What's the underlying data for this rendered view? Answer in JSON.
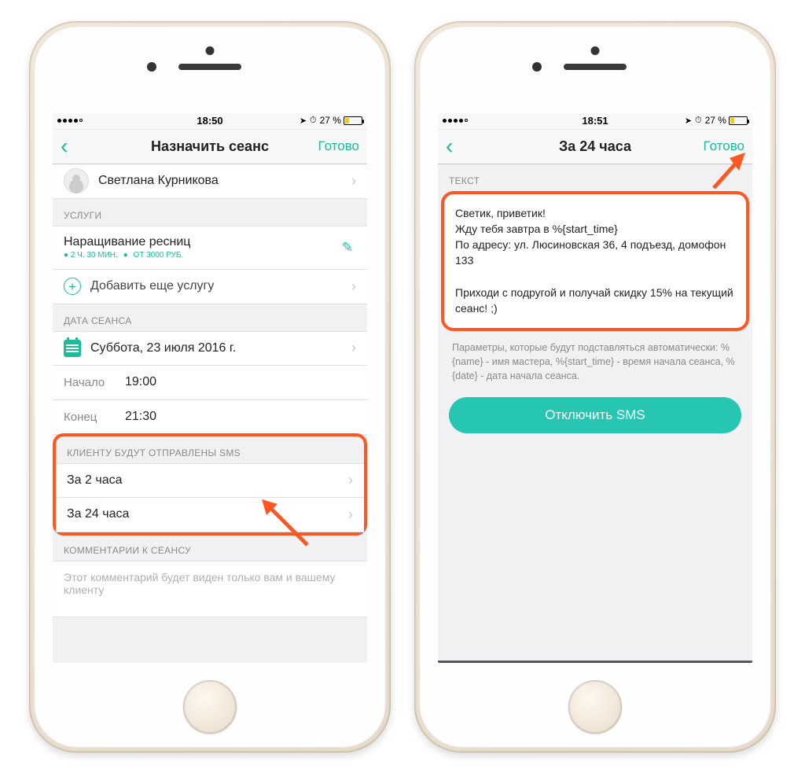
{
  "colors": {
    "accent": "#1abc9c",
    "highlight": "#ff5722"
  },
  "left": {
    "status": {
      "time": "18:50",
      "battery": "27 %"
    },
    "nav": {
      "title": "Назначить сеанс",
      "action": "Готово"
    },
    "client": {
      "name": "Светлана Курникова"
    },
    "sections": {
      "services": "УСЛУГИ",
      "date": "ДАТА СЕАНСА",
      "sms": "КЛИЕНТУ БУДУТ ОТПРАВЛЕНЫ SMS",
      "comments": "КОММЕНТАРИИ К СЕАНСУ"
    },
    "service": {
      "title": "Наращивание ресниц",
      "duration": "2 Ч. 30 МИН.",
      "price": "ОТ 3000 РУБ."
    },
    "add_service": "Добавить еще услугу",
    "date_row": "Суббота, 23 июля 2016 г.",
    "start": {
      "label": "Начало",
      "value": "19:00"
    },
    "end": {
      "label": "Конец",
      "value": "21:30"
    },
    "sms_rows": [
      "За 2 часа",
      "За 24 часа"
    ],
    "comment_placeholder": "Этот комментарий будет виден только вам и вашему клиенту"
  },
  "right": {
    "status": {
      "time": "18:51",
      "battery": "27 %"
    },
    "nav": {
      "title": "За 24 часа",
      "action": "Готово"
    },
    "section_text": "ТЕКСТ",
    "message": "Светик, приветик!\nЖду тебя завтра в %{start_time}\nПо адресу: ул. Люсиновская 36, 4 подъезд, домофон 133\n\nПриходи с подругой и получай скидку 15% на текущий сеанс! ;)",
    "help": "Параметры, которые будут подставляться автоматически: %{name} - имя мастера, %{start_time} - время начала сеанса, %{date} - дата начала сеанса.",
    "disable_btn": "Отключить SMS"
  }
}
